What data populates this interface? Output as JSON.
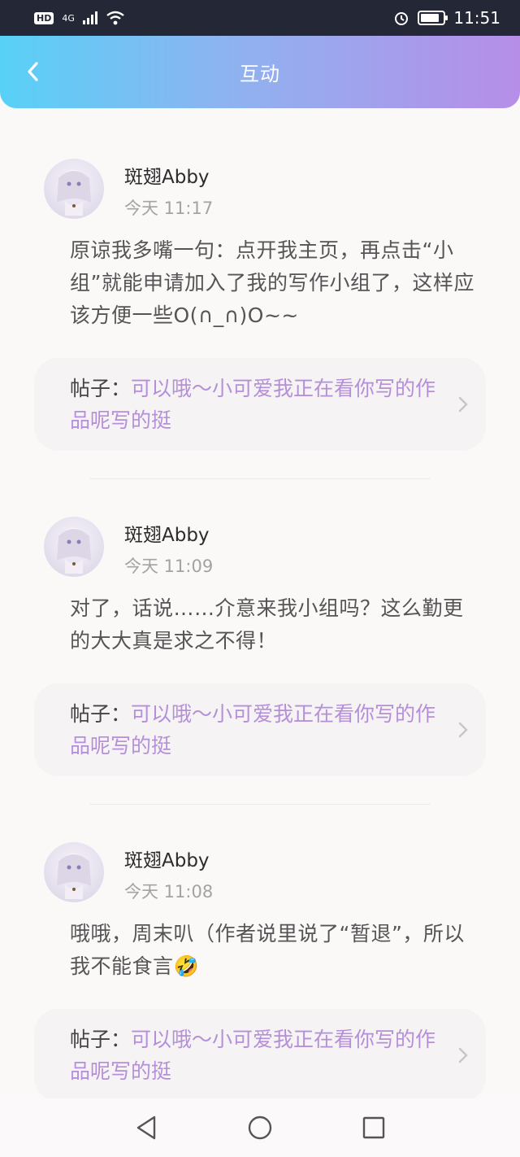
{
  "status_bar": {
    "network": "4G",
    "hd": "HD",
    "time": "11:51",
    "battery_level": 0.85
  },
  "header": {
    "title": "互动",
    "back_icon": "chevron-left-icon"
  },
  "items": [
    {
      "name": "斑翅Abby",
      "time": "今天 11:17",
      "content": "原谅我多嘴一句：点开我主页，再点击“小组”就能申请加入了我的写作小组了，这样应该方便一些O(∩_∩)O~~",
      "post_label": "帖子：",
      "post_title": "可以哦～小可爱我正在看你写的作品呢写的挺"
    },
    {
      "name": "斑翅Abby",
      "time": "今天 11:09",
      "content": "对了，话说……介意来我小组吗？这么勤更的大大真是求之不得！",
      "post_label": "帖子：",
      "post_title": "可以哦～小可爱我正在看你写的作品呢写的挺"
    },
    {
      "name": "斑翅Abby",
      "time": "今天 11:08",
      "content": "哦哦，周末叭（作者说里说了“暂退”，所以我不能食言🤣",
      "post_label": "帖子：",
      "post_title": "可以哦～小可爱我正在看你写的作品呢写的挺"
    }
  ],
  "nav": {
    "back": "triangle-back-icon",
    "home": "circle-home-icon",
    "recents": "square-recents-icon"
  },
  "colors": {
    "accent": "#b58fd9",
    "header_start": "#58d1f7",
    "header_end": "#b68ee8"
  }
}
